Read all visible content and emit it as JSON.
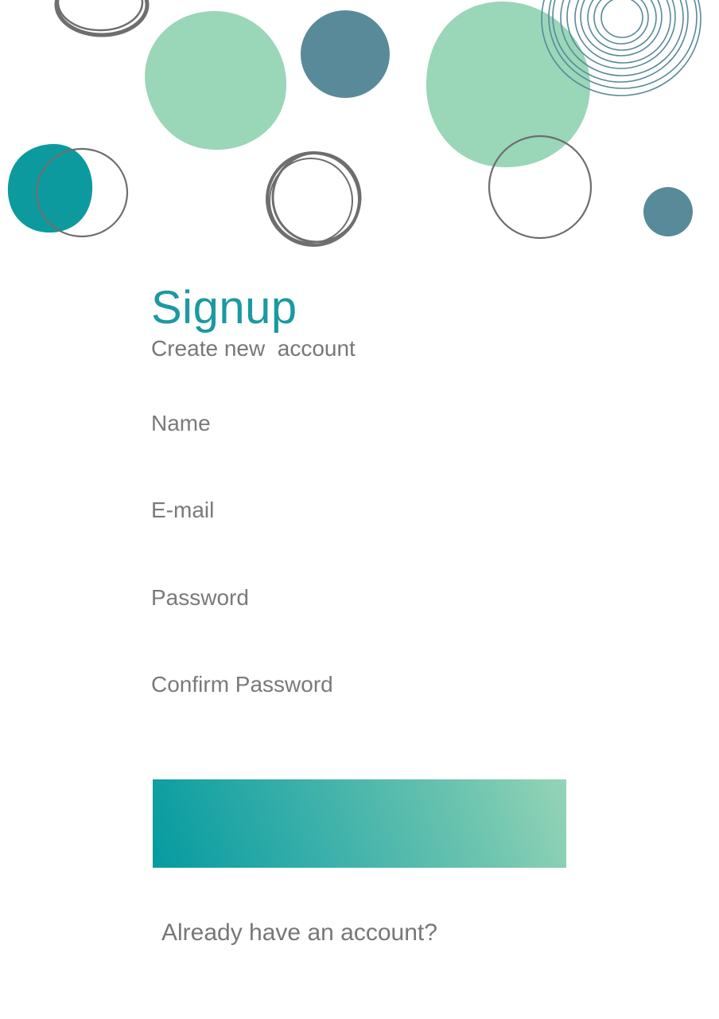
{
  "heading": {
    "title": "Signup",
    "subtitle": "Create new  account"
  },
  "form": {
    "name_placeholder": "Name",
    "email_placeholder": "E-mail",
    "password_placeholder": "Password",
    "confirm_password_placeholder": "Confirm Password",
    "submit_label": ""
  },
  "footer": {
    "login_link": "Already have an account?"
  },
  "colors": {
    "accent": "#1a9aa0",
    "mint": "#9ad6b8",
    "steel_blue": "#588a9a",
    "teal": "#0d9a9e",
    "outline_gray": "#6e6e6e",
    "gradient_start": "#059ba0",
    "gradient_end": "#95d4b7"
  }
}
